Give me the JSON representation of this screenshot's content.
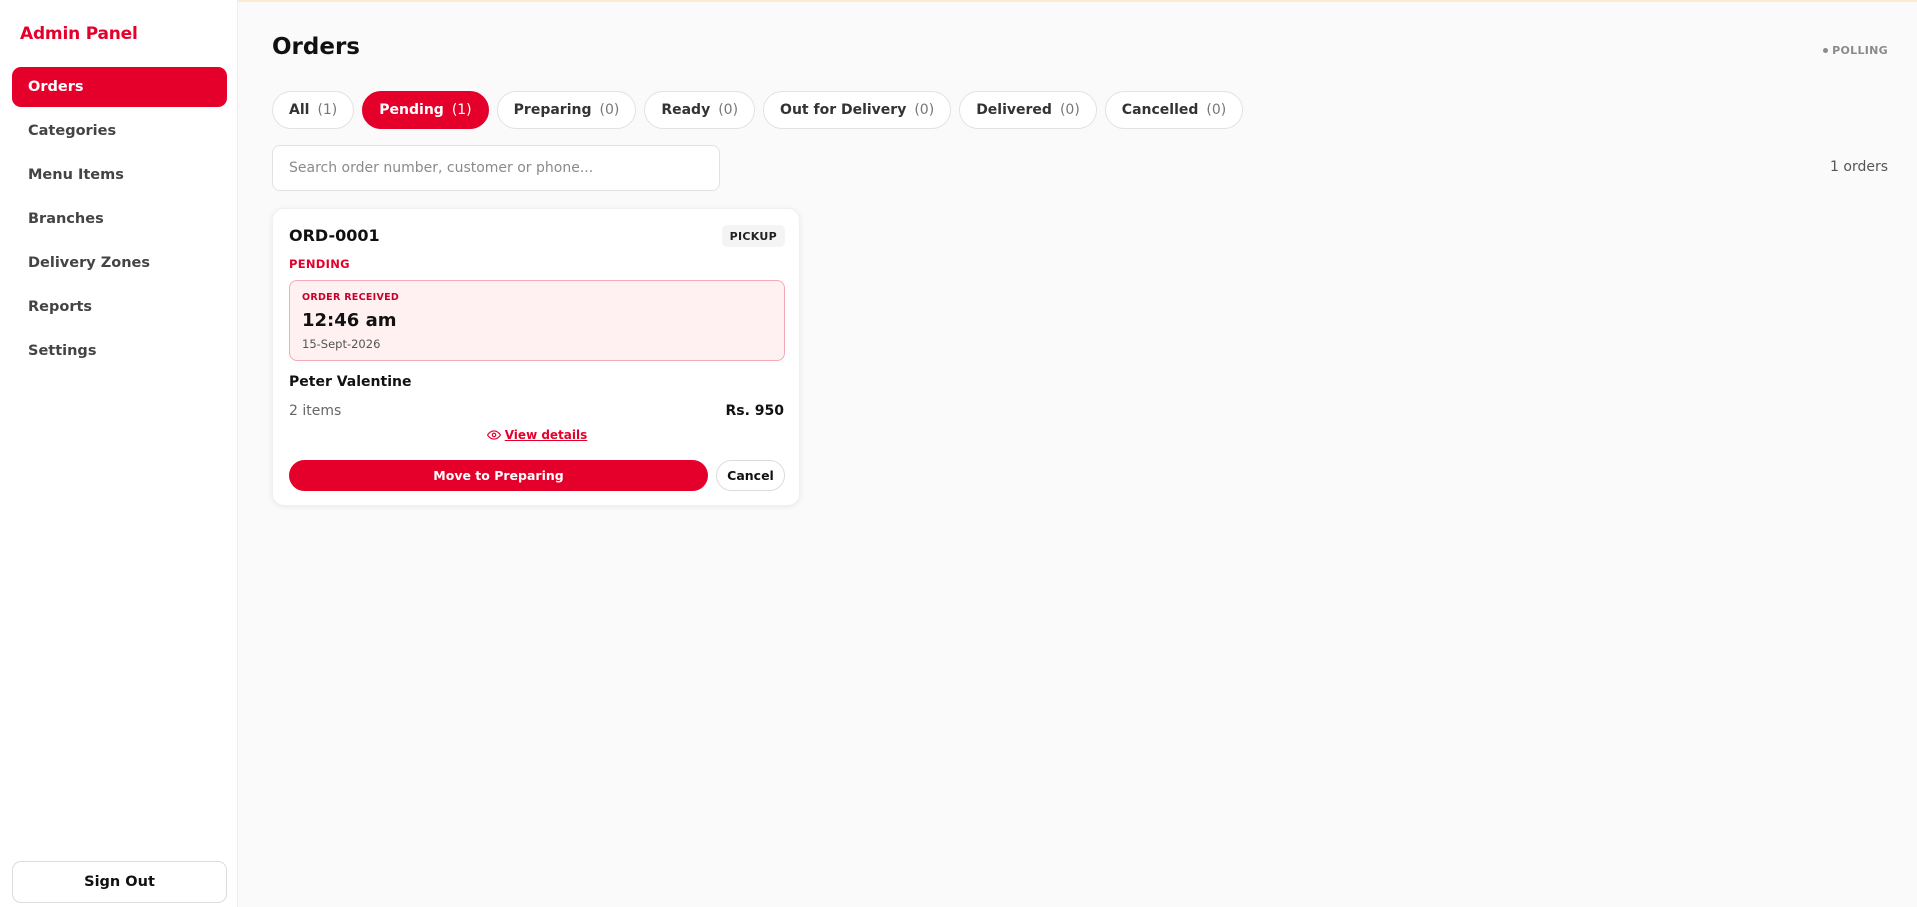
{
  "sidebar": {
    "brand": "Admin Panel",
    "items": [
      {
        "label": "Orders",
        "active": true
      },
      {
        "label": "Categories"
      },
      {
        "label": "Menu Items"
      },
      {
        "label": "Branches"
      },
      {
        "label": "Delivery Zones"
      },
      {
        "label": "Reports"
      },
      {
        "label": "Settings"
      }
    ],
    "sign_out": "Sign Out"
  },
  "header": {
    "title": "Orders",
    "status": "POLLING"
  },
  "tabs": [
    {
      "label": "All",
      "count": "(1)"
    },
    {
      "label": "Pending",
      "count": "(1)",
      "active": true
    },
    {
      "label": "Preparing",
      "count": "(0)"
    },
    {
      "label": "Ready",
      "count": "(0)"
    },
    {
      "label": "Out for Delivery",
      "count": "(0)"
    },
    {
      "label": "Delivered",
      "count": "(0)"
    },
    {
      "label": "Cancelled",
      "count": "(0)"
    }
  ],
  "search": {
    "placeholder": "Search order number, customer or phone...",
    "value": ""
  },
  "results_count": "1 orders",
  "order": {
    "number": "ORD-0001",
    "type": "PICKUP",
    "status": "PENDING",
    "received_label": "ORDER RECEIVED",
    "time": "12:46 am",
    "date": "15-Sept-2026",
    "customer": "Peter Valentine",
    "items": "2 items",
    "total": "Rs. 950",
    "view_details": "View details",
    "primary_action": "Move to Preparing",
    "secondary_action": "Cancel"
  },
  "colors": {
    "accent": "#e4002b",
    "received_bg": "#fff0f2",
    "received_border": "#f6a9b6"
  }
}
